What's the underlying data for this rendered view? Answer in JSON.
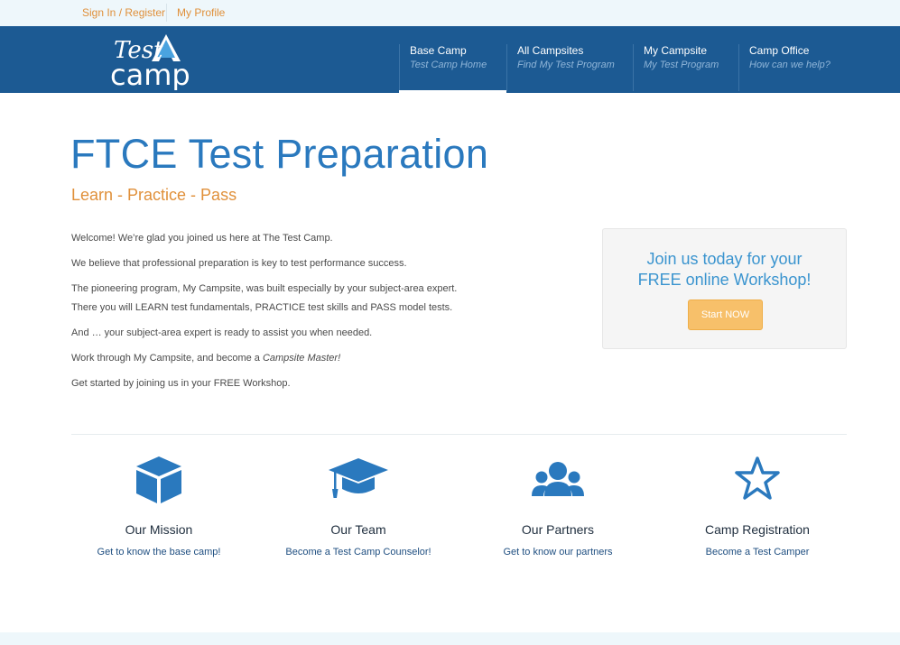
{
  "topbar": {
    "signin": "Sign In / Register",
    "profile": "My Profile"
  },
  "logo": {
    "line1": "Test",
    "line2": "camp"
  },
  "nav": [
    {
      "title": "Base Camp",
      "subtitle": "Test Camp Home",
      "active": true
    },
    {
      "title": "All Campsites",
      "subtitle": "Find My Test Program",
      "active": false
    },
    {
      "title": "My Campsite",
      "subtitle": "My Test Program",
      "active": false
    },
    {
      "title": "Camp Office",
      "subtitle": "How can we help?",
      "active": false
    }
  ],
  "page": {
    "title": "FTCE Test Preparation",
    "tagline": "Learn - Practice - Pass"
  },
  "intro": {
    "p1": "Welcome!  We’re glad you joined us here at The Test Camp.",
    "p2": "We believe that professional preparation is key to test performance success.",
    "p3": "The pioneering program, My Campsite, was built especially by your subject-area expert.",
    "p4": "There you will LEARN test fundamentals, PRACTICE test skills and PASS model tests.",
    "p5": "And … your subject-area expert is ready to assist you when needed.",
    "p6_pre": "Work through My Campsite, and become a ",
    "p6_em": "Campsite Master!",
    "p7": "Get started by joining us in your FREE Workshop."
  },
  "promo": {
    "line1": "Join us today for your",
    "line2": "FREE online Workshop!",
    "button": "Start NOW"
  },
  "features": [
    {
      "icon": "cube-icon",
      "title": "Our Mission",
      "link": "Get to know the base camp!"
    },
    {
      "icon": "graduation-cap-icon",
      "title": "Our Team",
      "link": "Become a Test Camp Counselor!"
    },
    {
      "icon": "group-icon",
      "title": "Our Partners",
      "link": "Get to know our partners"
    },
    {
      "icon": "star-icon",
      "title": "Camp Registration",
      "link": "Become a Test Camper"
    }
  ],
  "colors": {
    "brand_blue": "#1c5a93",
    "accent_orange": "#e0903a",
    "heading_blue": "#2a79be",
    "button_orange": "#f7c06a"
  }
}
